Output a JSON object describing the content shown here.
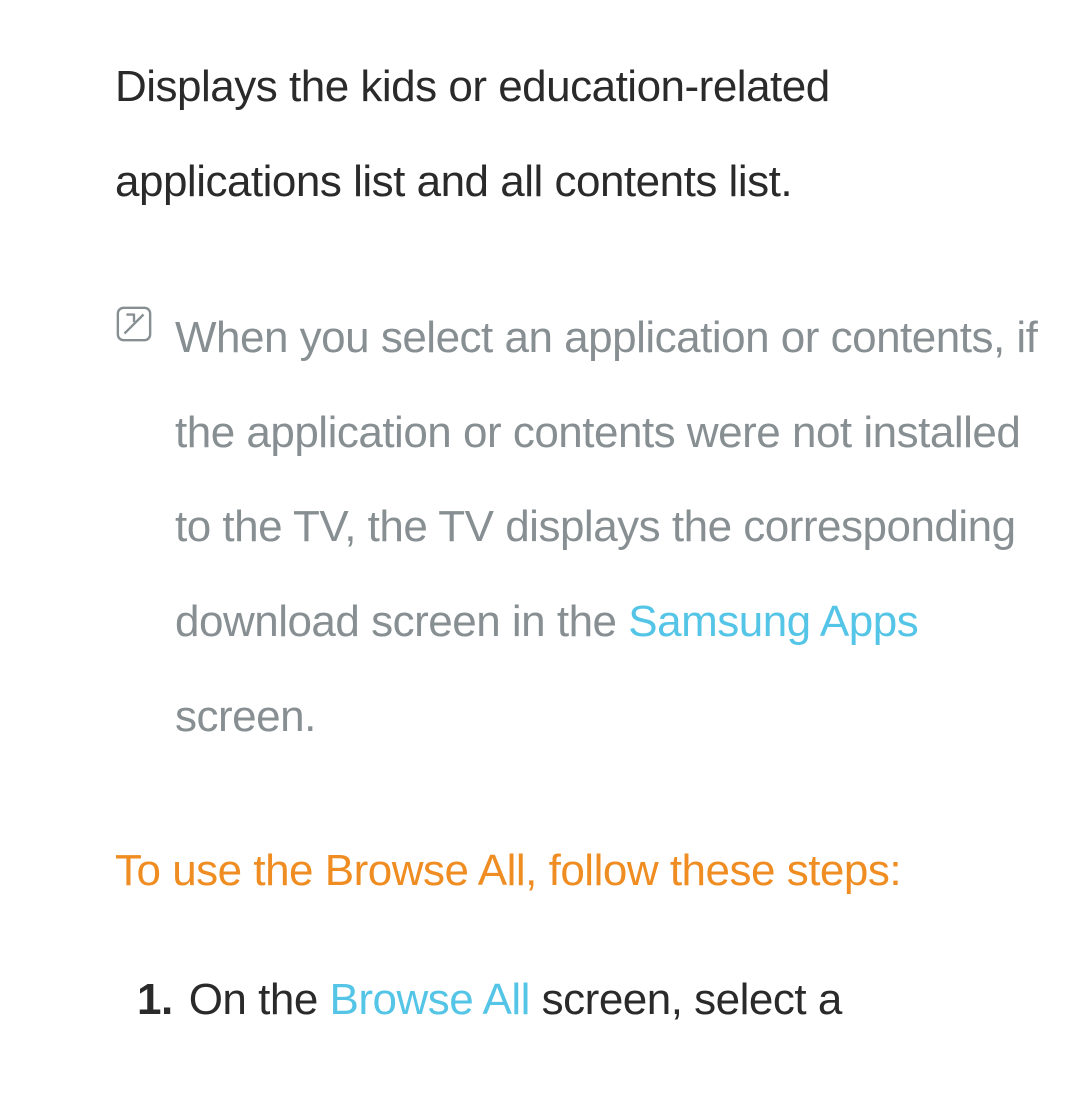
{
  "heading": "Displays the kids or education-related applications list and all contents list.",
  "note": {
    "part1": "When you select an application or contents, if the application or contents were not installed to the TV, the TV displays the corresponding download screen in the ",
    "highlight": "Samsung Apps",
    "part2": " screen."
  },
  "instruction": "To use the Browse All, follow these steps:",
  "step": {
    "num": "1.",
    "part1": "On the ",
    "highlight": "Browse All",
    "part2": " screen, select a"
  }
}
